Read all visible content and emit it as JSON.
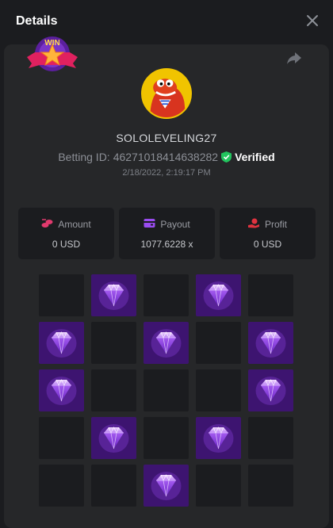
{
  "header": {
    "title": "Details"
  },
  "profile": {
    "username": "SOLOLEVELING27",
    "betting_id_label": "Betting ID:",
    "betting_id": "46271018414638282",
    "verified_label": "Verified",
    "timestamp": "2/18/2022, 2:19:17 PM",
    "badge_text": "WIN"
  },
  "stats": [
    {
      "label": "Amount",
      "value": "0 USD",
      "icon": "coins-icon",
      "color": "#e23a6e"
    },
    {
      "label": "Payout",
      "value": "1077.6228 x",
      "icon": "wallet-icon",
      "color": "#9a4cf0"
    },
    {
      "label": "Profit",
      "value": "0 USD",
      "icon": "hand-coin-icon",
      "color": "#e0333f"
    }
  ],
  "board": {
    "rows": [
      [
        false,
        true,
        false,
        true,
        false
      ],
      [
        true,
        false,
        true,
        false,
        true
      ],
      [
        true,
        false,
        false,
        false,
        true
      ],
      [
        false,
        true,
        false,
        true,
        false
      ],
      [
        false,
        false,
        true,
        false,
        false
      ]
    ],
    "gem_icon": "diamond-icon",
    "gem_tile_color": "#3d1470"
  }
}
